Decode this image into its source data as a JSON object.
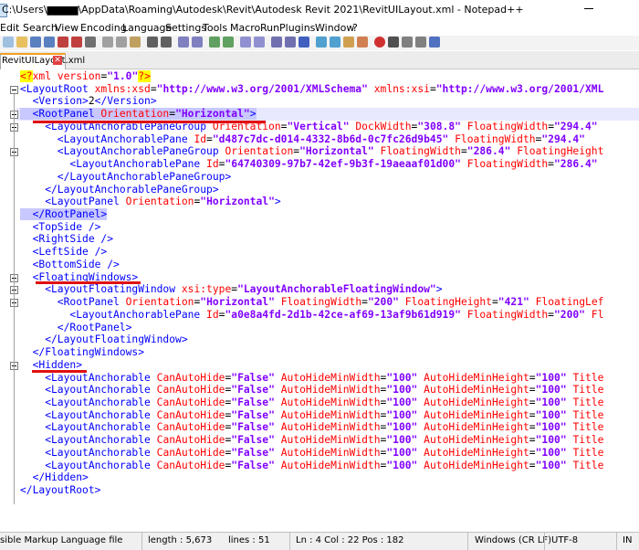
{
  "window": {
    "title": "C:\\Users\\▆▆▆▆\\AppData\\Roaming\\Autodesk\\Revit\\Autodesk Revit 2021\\RevitUILayout.xml - Notepad++",
    "minimize_glyph": "—"
  },
  "menu": [
    "Edit",
    "Search",
    "View",
    "Encoding",
    "Language",
    "Settings",
    "Tools",
    "Macro",
    "Run",
    "Plugins",
    "Window",
    "?"
  ],
  "tab": {
    "label": "RevitUILayout.xml",
    "close_glyph": "✕"
  },
  "lines": [
    {
      "segs": [
        [
          "pi",
          "<?"
        ],
        [
          "a",
          "xml version"
        ],
        [
          "x",
          "="
        ],
        [
          "v",
          "\"1.0\""
        ],
        [
          "pi",
          "?>"
        ]
      ]
    },
    {
      "segs": [
        [
          "t",
          "<LayoutRoot "
        ],
        [
          "a",
          "xmlns:xsd"
        ],
        [
          "x",
          "="
        ],
        [
          "v",
          "\"http://www.w3.org/2001/XMLSchema\""
        ],
        [
          "x",
          " "
        ],
        [
          "a",
          "xmlns:xsi"
        ],
        [
          "x",
          "="
        ],
        [
          "v",
          "\"http://www.w3.org/2001/XML"
        ]
      ]
    },
    {
      "segs": [
        [
          "t",
          "  <Version>"
        ],
        [
          "x",
          "2"
        ],
        [
          "t",
          "</Version>"
        ]
      ]
    },
    {
      "segs": [
        [
          "t",
          "  <RootPanel "
        ],
        [
          "a",
          "Orientation"
        ],
        [
          "x",
          "="
        ],
        [
          "v",
          "\"Horizontal\""
        ],
        [
          "t",
          ">"
        ]
      ]
    },
    {
      "segs": [
        [
          "t",
          "    <LayoutAnchorablePaneGroup "
        ],
        [
          "a",
          "Orientation"
        ],
        [
          "x",
          "="
        ],
        [
          "v",
          "\"Vertical\""
        ],
        [
          "x",
          " "
        ],
        [
          "a",
          "DockWidth"
        ],
        [
          "x",
          "="
        ],
        [
          "v",
          "\"308.8\""
        ],
        [
          "x",
          " "
        ],
        [
          "a",
          "FloatingWidth"
        ],
        [
          "x",
          "="
        ],
        [
          "v",
          "\"294.4\""
        ]
      ]
    },
    {
      "segs": [
        [
          "t",
          "      <LayoutAnchorablePane "
        ],
        [
          "a",
          "Id"
        ],
        [
          "x",
          "="
        ],
        [
          "v",
          "\"d487c7dc-d014-4332-8b6d-0c7fc26d9b45\""
        ],
        [
          "x",
          " "
        ],
        [
          "a",
          "FloatingWidth"
        ],
        [
          "x",
          "="
        ],
        [
          "v",
          "\"294.4\""
        ]
      ]
    },
    {
      "segs": [
        [
          "t",
          "      <LayoutAnchorablePaneGroup "
        ],
        [
          "a",
          "Orientation"
        ],
        [
          "x",
          "="
        ],
        [
          "v",
          "\"Horizontal\""
        ],
        [
          "x",
          " "
        ],
        [
          "a",
          "FloatingWidth"
        ],
        [
          "x",
          "="
        ],
        [
          "v",
          "\"286.4\""
        ],
        [
          "x",
          " "
        ],
        [
          "a",
          "FloatingHeight"
        ]
      ]
    },
    {
      "segs": [
        [
          "t",
          "        <LayoutAnchorablePane "
        ],
        [
          "a",
          "Id"
        ],
        [
          "x",
          "="
        ],
        [
          "v",
          "\"64740309-97b7-42ef-9b3f-19aeaaf01d00\""
        ],
        [
          "x",
          " "
        ],
        [
          "a",
          "FloatingWidth"
        ],
        [
          "x",
          "="
        ],
        [
          "v",
          "\"286.4\""
        ]
      ]
    },
    {
      "segs": [
        [
          "t",
          "      </LayoutAnchorablePaneGroup>"
        ]
      ]
    },
    {
      "segs": [
        [
          "t",
          "    </LayoutAnchorablePaneGroup>"
        ]
      ]
    },
    {
      "segs": [
        [
          "t",
          "    <LayoutPanel "
        ],
        [
          "a",
          "Orientation"
        ],
        [
          "x",
          "="
        ],
        [
          "v",
          "\"Horizontal\""
        ],
        [
          "t",
          ">"
        ]
      ]
    },
    {
      "segs": [
        [
          "t",
          "  </RootPanel>"
        ]
      ]
    },
    {
      "segs": [
        [
          "t",
          "  <TopSide />"
        ]
      ]
    },
    {
      "segs": [
        [
          "t",
          "  <RightSide />"
        ]
      ]
    },
    {
      "segs": [
        [
          "t",
          "  <LeftSide />"
        ]
      ]
    },
    {
      "segs": [
        [
          "t",
          "  <BottomSide />"
        ]
      ]
    },
    {
      "segs": [
        [
          "t",
          "  <FloatingWindows>"
        ]
      ]
    },
    {
      "segs": [
        [
          "t",
          "    <LayoutFloatingWindow "
        ],
        [
          "a",
          "xsi:type"
        ],
        [
          "x",
          "="
        ],
        [
          "v",
          "\"LayoutAnchorableFloatingWindow\""
        ],
        [
          "t",
          ">"
        ]
      ]
    },
    {
      "segs": [
        [
          "t",
          "      <RootPanel "
        ],
        [
          "a",
          "Orientation"
        ],
        [
          "x",
          "="
        ],
        [
          "v",
          "\"Horizontal\""
        ],
        [
          "x",
          " "
        ],
        [
          "a",
          "FloatingWidth"
        ],
        [
          "x",
          "="
        ],
        [
          "v",
          "\"200\""
        ],
        [
          "x",
          " "
        ],
        [
          "a",
          "FloatingHeight"
        ],
        [
          "x",
          "="
        ],
        [
          "v",
          "\"421\""
        ],
        [
          "x",
          " "
        ],
        [
          "a",
          "FloatingLef"
        ]
      ]
    },
    {
      "segs": [
        [
          "t",
          "        <LayoutAnchorablePane "
        ],
        [
          "a",
          "Id"
        ],
        [
          "x",
          "="
        ],
        [
          "v",
          "\"a0e8a4fd-2d1b-42ce-af69-13af9b61d919\""
        ],
        [
          "x",
          " "
        ],
        [
          "a",
          "FloatingWidth"
        ],
        [
          "x",
          "="
        ],
        [
          "v",
          "\"200\""
        ],
        [
          "x",
          " "
        ],
        [
          "a",
          "Fl"
        ]
      ]
    },
    {
      "segs": [
        [
          "t",
          "      </RootPanel>"
        ]
      ]
    },
    {
      "segs": [
        [
          "t",
          "    </LayoutFloatingWindow>"
        ]
      ]
    },
    {
      "segs": [
        [
          "t",
          "  </FloatingWindows>"
        ]
      ]
    },
    {
      "segs": [
        [
          "t",
          "  <Hidden>"
        ]
      ]
    },
    {
      "segs": [
        [
          "t",
          "    <LayoutAnchorable "
        ],
        [
          "a",
          "CanAutoHide"
        ],
        [
          "x",
          "="
        ],
        [
          "v",
          "\"False\""
        ],
        [
          "x",
          " "
        ],
        [
          "a",
          "AutoHideMinWidth"
        ],
        [
          "x",
          "="
        ],
        [
          "v",
          "\"100\""
        ],
        [
          "x",
          " "
        ],
        [
          "a",
          "AutoHideMinHeight"
        ],
        [
          "x",
          "="
        ],
        [
          "v",
          "\"100\""
        ],
        [
          "x",
          " "
        ],
        [
          "a",
          "Title"
        ]
      ]
    },
    {
      "segs": [
        [
          "t",
          "    <LayoutAnchorable "
        ],
        [
          "a",
          "CanAutoHide"
        ],
        [
          "x",
          "="
        ],
        [
          "v",
          "\"False\""
        ],
        [
          "x",
          " "
        ],
        [
          "a",
          "AutoHideMinWidth"
        ],
        [
          "x",
          "="
        ],
        [
          "v",
          "\"100\""
        ],
        [
          "x",
          " "
        ],
        [
          "a",
          "AutoHideMinHeight"
        ],
        [
          "x",
          "="
        ],
        [
          "v",
          "\"100\""
        ],
        [
          "x",
          " "
        ],
        [
          "a",
          "Title"
        ]
      ]
    },
    {
      "segs": [
        [
          "t",
          "    <LayoutAnchorable "
        ],
        [
          "a",
          "CanAutoHide"
        ],
        [
          "x",
          "="
        ],
        [
          "v",
          "\"False\""
        ],
        [
          "x",
          " "
        ],
        [
          "a",
          "AutoHideMinWidth"
        ],
        [
          "x",
          "="
        ],
        [
          "v",
          "\"100\""
        ],
        [
          "x",
          " "
        ],
        [
          "a",
          "AutoHideMinHeight"
        ],
        [
          "x",
          "="
        ],
        [
          "v",
          "\"100\""
        ],
        [
          "x",
          " "
        ],
        [
          "a",
          "Title"
        ]
      ]
    },
    {
      "segs": [
        [
          "t",
          "    <LayoutAnchorable "
        ],
        [
          "a",
          "CanAutoHide"
        ],
        [
          "x",
          "="
        ],
        [
          "v",
          "\"False\""
        ],
        [
          "x",
          " "
        ],
        [
          "a",
          "AutoHideMinWidth"
        ],
        [
          "x",
          "="
        ],
        [
          "v",
          "\"100\""
        ],
        [
          "x",
          " "
        ],
        [
          "a",
          "AutoHideMinHeight"
        ],
        [
          "x",
          "="
        ],
        [
          "v",
          "\"100\""
        ],
        [
          "x",
          " "
        ],
        [
          "a",
          "Title"
        ]
      ]
    },
    {
      "segs": [
        [
          "t",
          "    <LayoutAnchorable "
        ],
        [
          "a",
          "CanAutoHide"
        ],
        [
          "x",
          "="
        ],
        [
          "v",
          "\"False\""
        ],
        [
          "x",
          " "
        ],
        [
          "a",
          "AutoHideMinWidth"
        ],
        [
          "x",
          "="
        ],
        [
          "v",
          "\"100\""
        ],
        [
          "x",
          " "
        ],
        [
          "a",
          "AutoHideMinHeight"
        ],
        [
          "x",
          "="
        ],
        [
          "v",
          "\"100\""
        ],
        [
          "x",
          " "
        ],
        [
          "a",
          "Title"
        ]
      ]
    },
    {
      "segs": [
        [
          "t",
          "    <LayoutAnchorable "
        ],
        [
          "a",
          "CanAutoHide"
        ],
        [
          "x",
          "="
        ],
        [
          "v",
          "\"False\""
        ],
        [
          "x",
          " "
        ],
        [
          "a",
          "AutoHideMinWidth"
        ],
        [
          "x",
          "="
        ],
        [
          "v",
          "\"100\""
        ],
        [
          "x",
          " "
        ],
        [
          "a",
          "AutoHideMinHeight"
        ],
        [
          "x",
          "="
        ],
        [
          "v",
          "\"100\""
        ],
        [
          "x",
          " "
        ],
        [
          "a",
          "Title"
        ]
      ]
    },
    {
      "segs": [
        [
          "t",
          "    <LayoutAnchorable "
        ],
        [
          "a",
          "CanAutoHide"
        ],
        [
          "x",
          "="
        ],
        [
          "v",
          "\"False\""
        ],
        [
          "x",
          " "
        ],
        [
          "a",
          "AutoHideMinWidth"
        ],
        [
          "x",
          "="
        ],
        [
          "v",
          "\"100\""
        ],
        [
          "x",
          " "
        ],
        [
          "a",
          "AutoHideMinHeight"
        ],
        [
          "x",
          "="
        ],
        [
          "v",
          "\"100\""
        ],
        [
          "x",
          " "
        ],
        [
          "a",
          "Title"
        ]
      ]
    },
    {
      "segs": [
        [
          "t",
          "    <LayoutAnchorable "
        ],
        [
          "a",
          "CanAutoHide"
        ],
        [
          "x",
          "="
        ],
        [
          "v",
          "\"False\""
        ],
        [
          "x",
          " "
        ],
        [
          "a",
          "AutoHideMinWidth"
        ],
        [
          "x",
          "="
        ],
        [
          "v",
          "\"100\""
        ],
        [
          "x",
          " "
        ],
        [
          "a",
          "AutoHideMinHeight"
        ],
        [
          "x",
          "="
        ],
        [
          "v",
          "\"100\""
        ],
        [
          "x",
          " "
        ],
        [
          "a",
          "Title"
        ]
      ]
    },
    {
      "segs": [
        [
          "t",
          "  </Hidden>"
        ]
      ]
    },
    {
      "segs": [
        [
          "t",
          "</LayoutRoot>"
        ]
      ]
    }
  ],
  "status": {
    "language": "sible Markup Language file",
    "length": "length : 5,673",
    "lines": "lines : 51",
    "cursor": "Ln : 4    Col : 22    Pos : 182",
    "eol": "Windows (CR LF)",
    "encoding": "UTF-8",
    "mode": "IN"
  },
  "colors": {
    "tag": "#0000ff",
    "attr": "#ff0000",
    "value": "#8000ff",
    "annotation": "#e01010"
  }
}
